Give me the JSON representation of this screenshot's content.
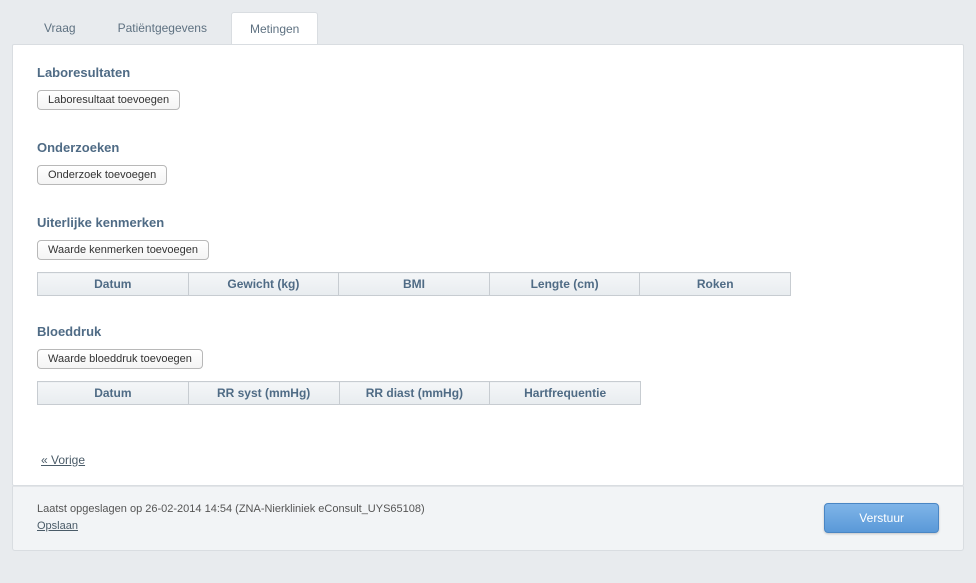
{
  "tabs": [
    {
      "label": "Vraag"
    },
    {
      "label": "Patiëntgegevens"
    },
    {
      "label": "Metingen"
    }
  ],
  "sections": {
    "lab": {
      "title": "Laboresultaten",
      "add_btn": "Laboresultaat toevoegen"
    },
    "onderzoek": {
      "title": "Onderzoeken",
      "add_btn": "Onderzoek toevoegen"
    },
    "uiterlijk": {
      "title": "Uiterlijke kenmerken",
      "add_btn": "Waarde kenmerken toevoegen",
      "cols": [
        "Datum",
        "Gewicht (kg)",
        "BMI",
        "Lengte (cm)",
        "Roken"
      ]
    },
    "bloeddruk": {
      "title": "Bloeddruk",
      "add_btn": "Waarde bloeddruk toevoegen",
      "cols": [
        "Datum",
        "RR syst (mmHg)",
        "RR diast (mmHg)",
        "Hartfrequentie"
      ]
    }
  },
  "nav": {
    "prev": "« Vorige"
  },
  "footer": {
    "saved_text": "Laatst opgeslagen op 26-02-2014 14:54 (ZNA-Nierkliniek eConsult_UYS65108)",
    "save_link": "Opslaan",
    "submit_btn": "Verstuur"
  }
}
